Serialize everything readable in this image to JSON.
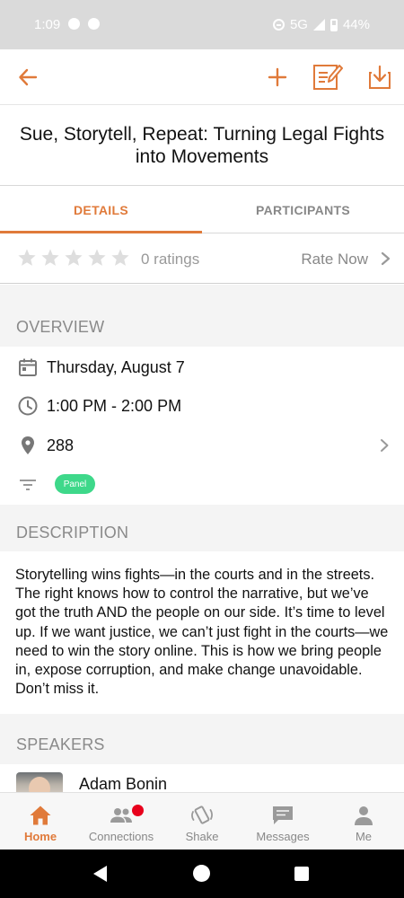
{
  "status_bar": {
    "time": "1:09",
    "network": "5G",
    "battery": "44%"
  },
  "toolbar": {
    "back_icon": "arrow-left-icon",
    "add_icon": "plus-icon",
    "notes_icon": "note-edit-icon",
    "download_icon": "download-icon",
    "accent_color": "#e07a3a"
  },
  "session": {
    "title": "Sue, Storytell, Repeat: Turning Legal Fights into Movements"
  },
  "tabs": [
    {
      "label": "DETAILS",
      "active": true
    },
    {
      "label": "PARTICIPANTS",
      "active": false
    }
  ],
  "rating": {
    "stars_filled": 0,
    "stars_total": 5,
    "count_label": "0 ratings",
    "rate_now_label": "Rate Now"
  },
  "overview": {
    "heading": "OVERVIEW",
    "date": "Thursday, August 7",
    "time": "1:00 PM - 2:00 PM",
    "location": "288",
    "tag": "Panel",
    "tag_color": "#3ed88a"
  },
  "description": {
    "heading": "DESCRIPTION",
    "text": "Storytelling wins fights—in the courts and in the streets. The right knows how to control the narrative, but we’ve got the truth AND the people on our side. It’s time to level up. If we want justice, we can’t just fight in the courts—we need to win the story online. This is how we bring people in, expose corruption, and make change unavoidable. Don’t miss it."
  },
  "speakers": {
    "heading": "SPEAKERS",
    "items": [
      {
        "name": "Adam Bonin"
      }
    ]
  },
  "bottom_nav": [
    {
      "label": "Home",
      "icon": "home-icon",
      "active": true
    },
    {
      "label": "Connections",
      "icon": "people-icon",
      "active": false,
      "has_notification": true
    },
    {
      "label": "Shake",
      "icon": "shake-phone-icon",
      "active": false
    },
    {
      "label": "Messages",
      "icon": "message-icon",
      "active": false
    },
    {
      "label": "Me",
      "icon": "person-icon",
      "active": false
    }
  ]
}
